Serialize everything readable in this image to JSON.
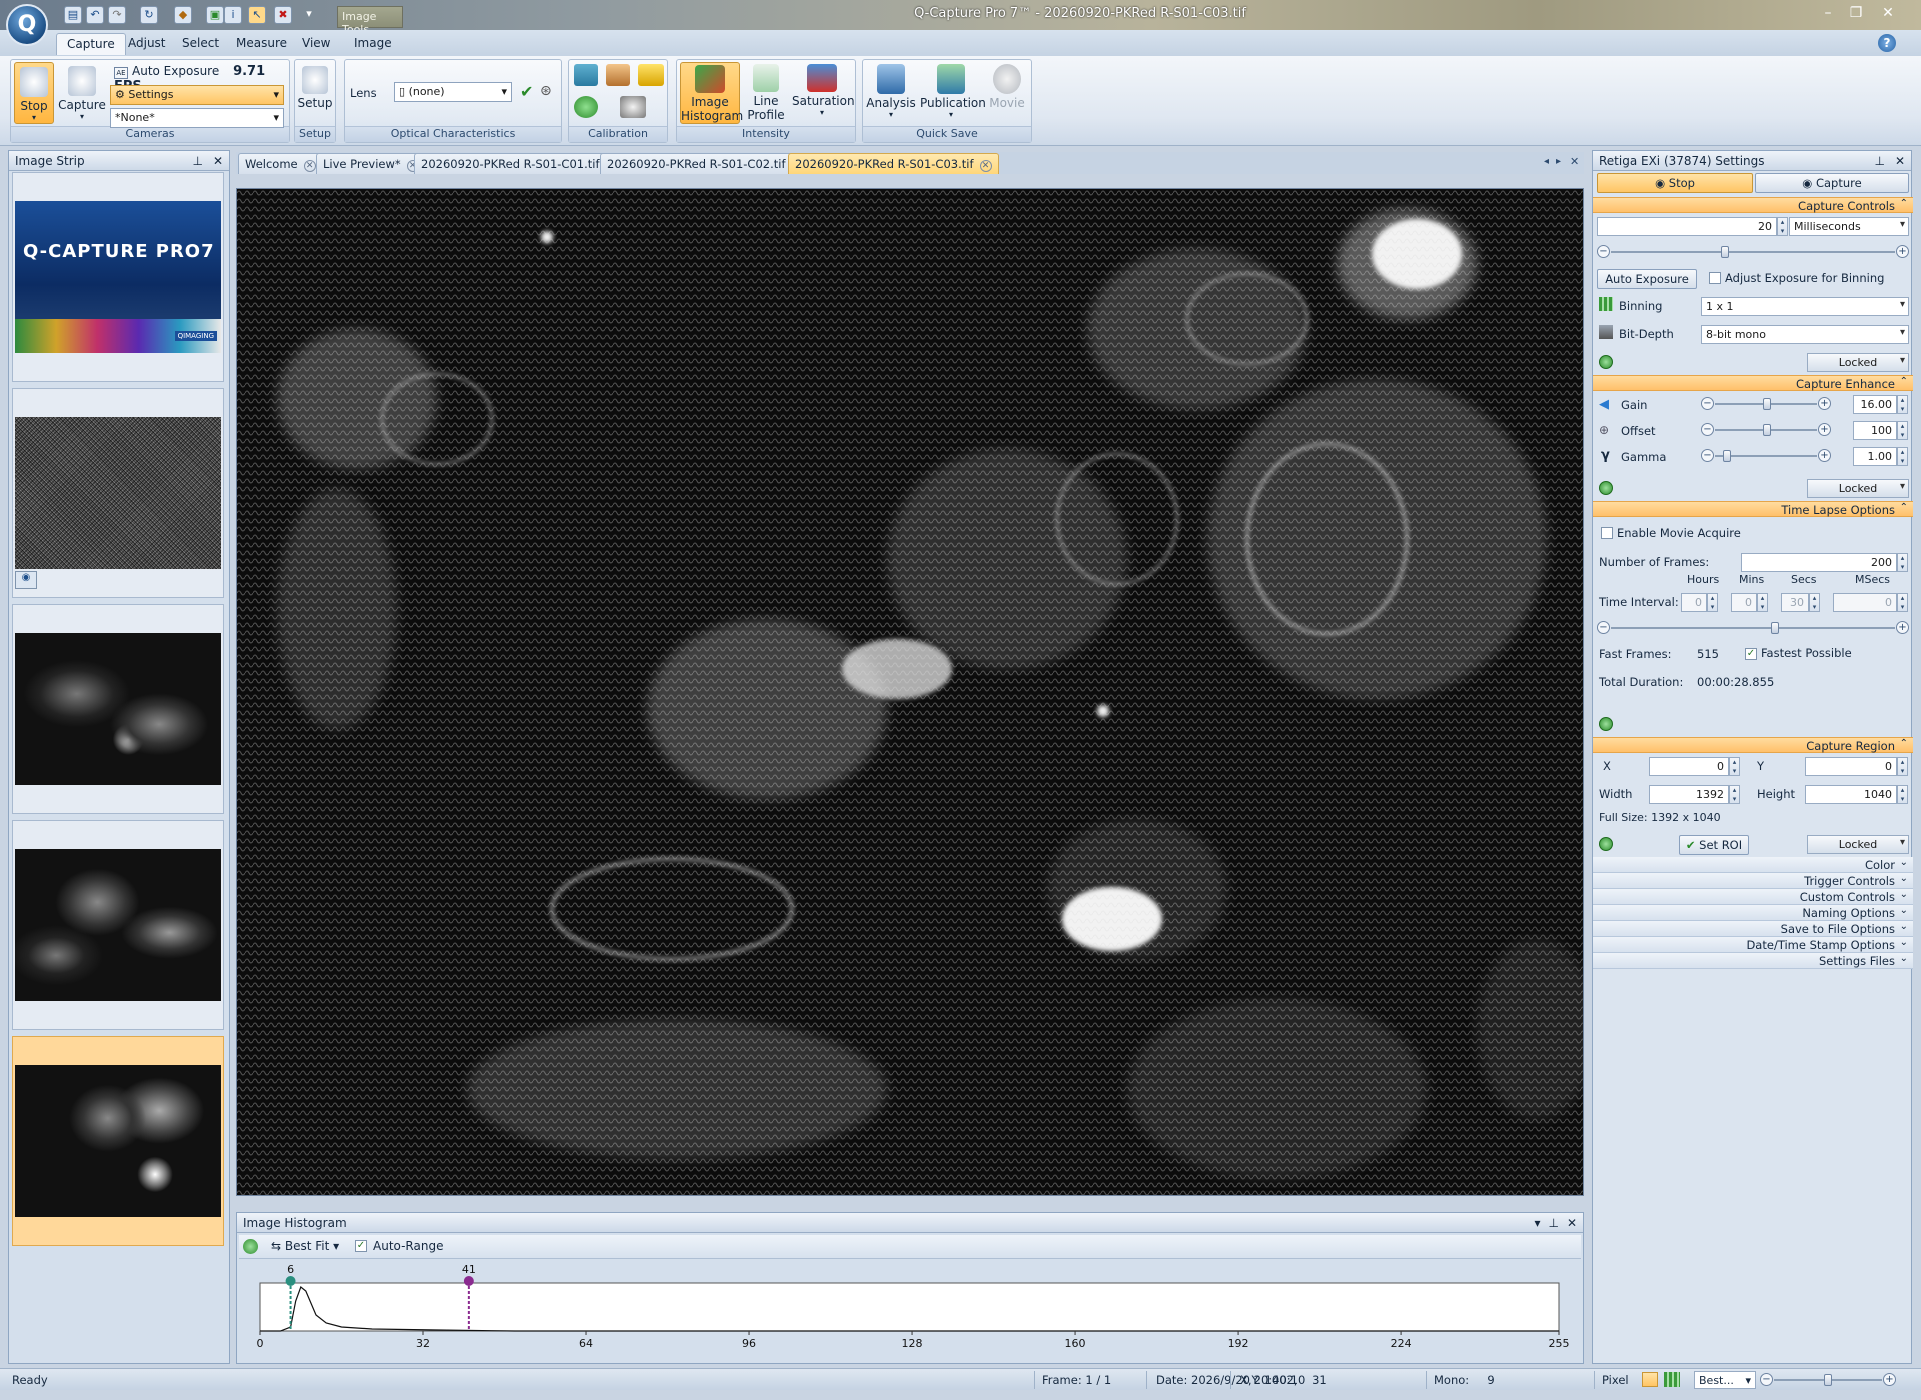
{
  "window": {
    "title": "Q-Capture Pro 7™ - 20260920-PKRed R-S01-C03.tif",
    "context_tab": "Image Tools",
    "app_logo": "Q"
  },
  "ribbon_tabs": [
    "Capture",
    "Adjust",
    "Select",
    "Measure",
    "View",
    "Image"
  ],
  "ribbon": {
    "stop_label": "Stop",
    "capture_label": "Capture",
    "auto_exposure_label": "Auto Exposure",
    "fps": "9.71 FPS",
    "settings_label": "Settings",
    "settings_preset": "*None*",
    "cameras_group": "Cameras",
    "setup_label": "Setup",
    "setup_group": "Setup",
    "lens_label": "Lens",
    "lens_value": "(none)",
    "optical_group": "Optical Characteristics",
    "calibration_group": "Calibration",
    "image_histogram_label": "Image Histogram",
    "line_profile_label": "Line Profile",
    "saturation_label": "Saturation",
    "intensity_group": "Intensity",
    "analysis_label": "Analysis",
    "publication_label": "Publication",
    "movie_label": "Movie",
    "quicksave_group": "Quick Save"
  },
  "image_strip": {
    "title": "Image Strip",
    "splash_text": "Q-CAPTURE PRO7",
    "splash_badge": "QIMAGING"
  },
  "doc_tabs": [
    "Welcome",
    "Live Preview*",
    "20260920-PKRed R-S01-C01.tif",
    "20260920-PKRed R-S01-C02.tif",
    "20260920-PKRed R-S01-C03.tif"
  ],
  "histogram": {
    "title": "Image Histogram",
    "fit_label": "Best Fit",
    "auto_range_label": "Auto-Range",
    "low_marker": "6",
    "high_marker": "41",
    "axis_ticks": [
      "0",
      "32",
      "64",
      "96",
      "128",
      "160",
      "192",
      "224",
      "255"
    ]
  },
  "settings": {
    "title": "Retiga EXi (37874) Settings",
    "stop_label": "Stop",
    "capture_label": "Capture",
    "capture_controls": "Capture Controls",
    "exposure_value": "20",
    "exposure_unit": "Milliseconds",
    "auto_exposure_btn": "Auto Exposure",
    "adjust_binning_label": "Adjust Exposure for Binning",
    "binning_label": "Binning",
    "binning_value": "1 x 1",
    "bitdepth_label": "Bit-Depth",
    "bitdepth_value": "8-bit mono",
    "locked": "Locked",
    "capture_enhance": "Capture Enhance",
    "gain_label": "Gain",
    "gain_value": "16.00",
    "offset_label": "Offset",
    "offset_value": "100",
    "gamma_label": "Gamma",
    "gamma_value": "1.00",
    "time_lapse": "Time Lapse Options",
    "enable_movie_label": "Enable Movie Acquire",
    "num_frames_label": "Number of Frames:",
    "num_frames_value": "200",
    "hours_label": "Hours",
    "mins_label": "Mins",
    "secs_label": "Secs",
    "msecs_label": "MSecs",
    "time_interval_label": "Time Interval:",
    "hours_value": "0",
    "mins_value": "0",
    "secs_value": "30",
    "msecs_value": "0",
    "fast_frames_label": "Fast Frames:",
    "fast_frames_value": "515",
    "fastest_possible_label": "Fastest Possible",
    "total_duration_label": "Total Duration:",
    "total_duration_value": "00:00:28.855",
    "capture_region": "Capture Region",
    "x_label": "X",
    "x_value": "0",
    "y_label": "Y",
    "y_value": "0",
    "width_label": "Width",
    "width_value": "1392",
    "height_label": "Height",
    "height_value": "1040",
    "full_size": "Full Size: 1392 x 1040",
    "set_roi_label": "Set ROI",
    "collapsed_sections": [
      "Color",
      "Trigger Controls",
      "Custom Controls",
      "Naming Options",
      "Save to File Options",
      "Date/Time Stamp Options",
      "Settings Files"
    ]
  },
  "status": {
    "ready": "Ready",
    "frame": "Frame: 1 / 1",
    "date": "Date: 2026/9/20 20:40:10",
    "xy": "X,Y: 1002,    31",
    "mono": "Mono:     9",
    "pixel": "Pixel",
    "zoom_mode": "Best..."
  },
  "colors": {
    "accent_orange": "#ffc06a",
    "panel_blue": "#d4dfec",
    "marker_teal": "#2a8f7f",
    "marker_purple": "#8a2a8f"
  }
}
